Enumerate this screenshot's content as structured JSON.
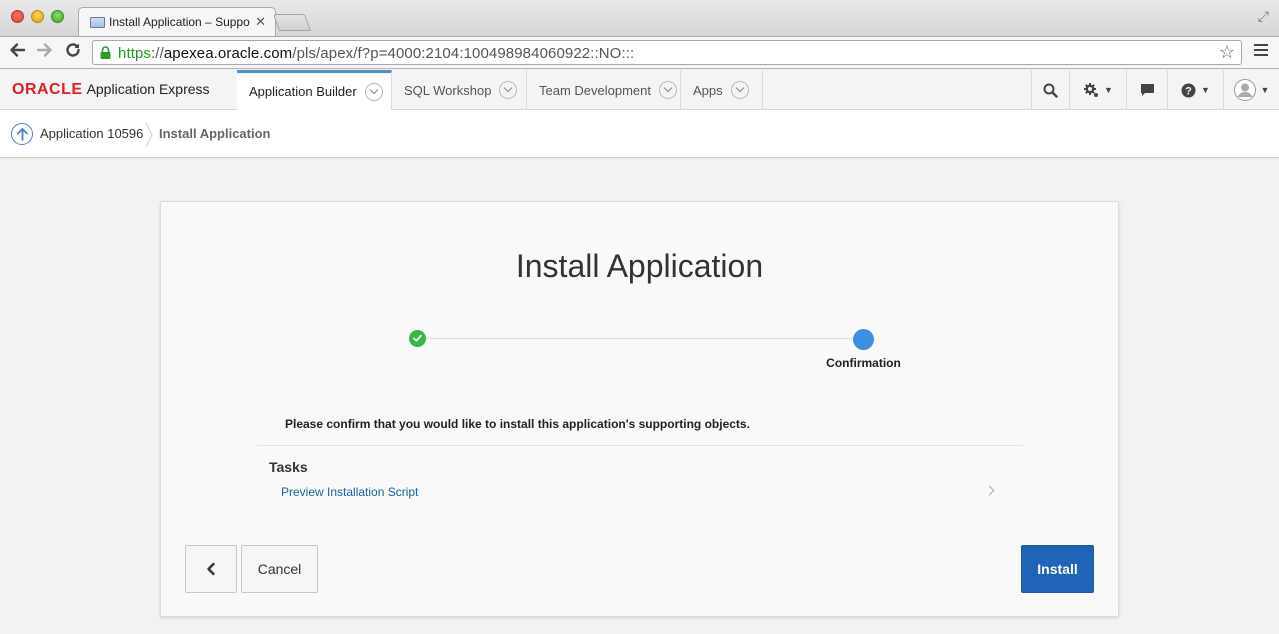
{
  "browser": {
    "tab_title": "Install Application – Suppo",
    "url_scheme": "https",
    "url_sep": "://",
    "url_host": "apexea.oracle.com",
    "url_path": "/pls/apex/f?p=4000:2104:100498984060922::NO:::"
  },
  "header": {
    "brand": "ORACLE",
    "product": "Application Express",
    "tabs": [
      {
        "label": "Application Builder",
        "active": true
      },
      {
        "label": "SQL Workshop",
        "active": false
      },
      {
        "label": "Team Development",
        "active": false
      },
      {
        "label": "Apps",
        "active": false
      }
    ],
    "icons": [
      "search-icon",
      "gear-icon",
      "chat-icon",
      "help-icon",
      "user-icon"
    ]
  },
  "breadcrumb": {
    "parent": "Application 10596",
    "current": "Install Application"
  },
  "dialog": {
    "title": "Install Application",
    "steps": [
      {
        "status": "complete",
        "label": ""
      },
      {
        "status": "current",
        "label": "Confirmation"
      }
    ],
    "message": "Please confirm that you would like to install this application's supporting objects.",
    "tasks_heading": "Tasks",
    "tasks": [
      "Preview Installation Script"
    ],
    "buttons": {
      "previous": "<",
      "cancel": "Cancel",
      "install": "Install"
    }
  },
  "colors": {
    "oracle_red": "#e31e24",
    "primary_button": "#1f64b8",
    "step_complete": "#39b54a",
    "step_current": "#3d8ee0",
    "link": "#1a5fa8"
  }
}
